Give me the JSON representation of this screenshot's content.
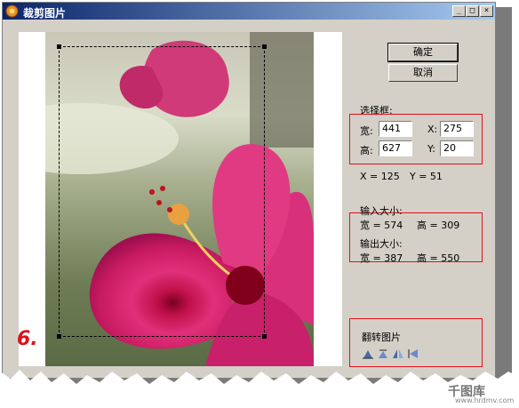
{
  "window": {
    "title": "裁剪图片",
    "min_label": "_",
    "max_label": "□",
    "close_label": "×"
  },
  "buttons": {
    "ok": "确定",
    "cancel": "取消"
  },
  "selection": {
    "heading": "选择框:",
    "width_label": "宽:",
    "width_value": "441",
    "height_label": "高:",
    "height_value": "627",
    "x_label": "X:",
    "x_value": "275",
    "y_label": "Y:",
    "y_value": "20",
    "cursor_x": "X = 125",
    "cursor_y": "Y = 51"
  },
  "input_size": {
    "heading": "输入大小:",
    "width": "宽 = 574",
    "height": "高 = 309"
  },
  "output_size": {
    "heading": "输出大小:",
    "width": "宽 = 387",
    "height": "高 = 550"
  },
  "flip": {
    "heading": "翻转图片",
    "icons": [
      "flip-vertical-icon",
      "flip-up-icon",
      "flip-horizontal-icon",
      "flip-left-icon"
    ]
  },
  "annotation": {
    "step_label": "6."
  },
  "watermark": {
    "site": "www.hrdmv.com"
  },
  "colors": {
    "title_start": "#0a246a",
    "title_end": "#a6caf0",
    "highlight": "#e0101a",
    "face": "#d4d0c8"
  }
}
